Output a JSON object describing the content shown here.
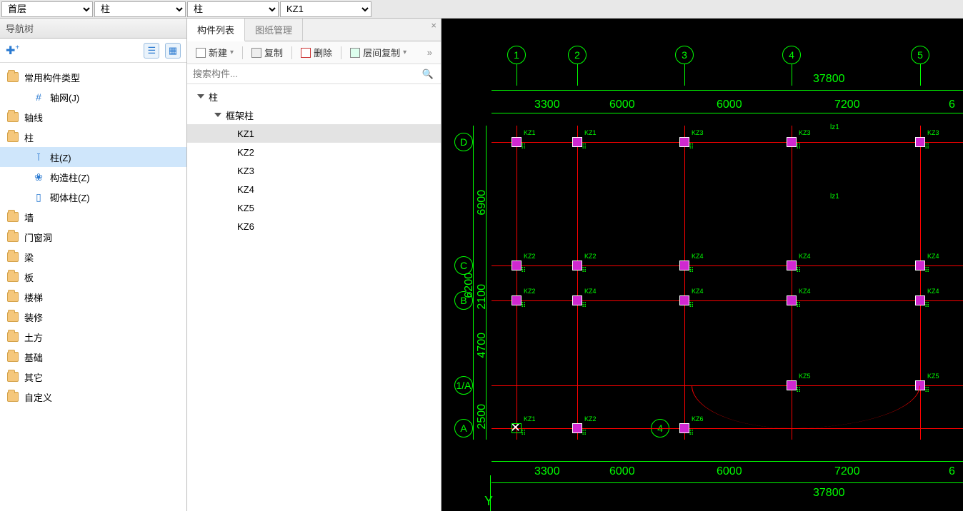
{
  "topbar": {
    "floor": "首层",
    "cat1": "柱",
    "cat2": "柱",
    "item": "KZ1"
  },
  "leftPanel": {
    "title": "导航树",
    "addTip": "+",
    "items": [
      {
        "label": "常用构件类型",
        "type": "folder",
        "lvl": 0
      },
      {
        "label": "轴网(J)",
        "type": "leaf",
        "lvl": 1,
        "icon": "#"
      },
      {
        "label": "轴线",
        "type": "folder",
        "lvl": 0
      },
      {
        "label": "柱",
        "type": "folder",
        "lvl": 0
      },
      {
        "label": "柱(Z)",
        "type": "leaf",
        "lvl": 1,
        "icon": "⊺",
        "sel": true
      },
      {
        "label": "构造柱(Z)",
        "type": "leaf",
        "lvl": 1,
        "icon": "❀"
      },
      {
        "label": "砌体柱(Z)",
        "type": "leaf",
        "lvl": 1,
        "icon": "▯"
      },
      {
        "label": "墙",
        "type": "folder",
        "lvl": 0
      },
      {
        "label": "门窗洞",
        "type": "folder",
        "lvl": 0
      },
      {
        "label": "梁",
        "type": "folder",
        "lvl": 0
      },
      {
        "label": "板",
        "type": "folder",
        "lvl": 0
      },
      {
        "label": "楼梯",
        "type": "folder",
        "lvl": 0
      },
      {
        "label": "装修",
        "type": "folder",
        "lvl": 0
      },
      {
        "label": "土方",
        "type": "folder",
        "lvl": 0
      },
      {
        "label": "基础",
        "type": "folder",
        "lvl": 0
      },
      {
        "label": "其它",
        "type": "folder",
        "lvl": 0
      },
      {
        "label": "自定义",
        "type": "folder",
        "lvl": 0
      }
    ]
  },
  "midPanel": {
    "tabs": {
      "list": "构件列表",
      "draw": "图纸管理"
    },
    "toolbar": {
      "new": "新建",
      "copy": "复制",
      "del": "删除",
      "floorcopy": "层间复制"
    },
    "searchPlaceholder": "搜索构件...",
    "tree": {
      "root": "柱",
      "group": "框架柱",
      "items": [
        "KZ1",
        "KZ2",
        "KZ3",
        "KZ4",
        "KZ5",
        "KZ6"
      ],
      "selected": "KZ1"
    }
  },
  "cad": {
    "topBubbles": [
      "1",
      "2",
      "3",
      "4",
      "5"
    ],
    "leftBubbles": [
      "D",
      "C",
      "B",
      "1/A",
      "A"
    ],
    "extraBubble": "4",
    "dimsTop": [
      "3300",
      "6000",
      "6000",
      "7200",
      "6"
    ],
    "totalTop": "37800",
    "totalBottom": "37800",
    "dimsBottom": [
      "3300",
      "6000",
      "6000",
      "7200",
      "6"
    ],
    "dimsLeft": [
      "6900",
      "2100",
      "4700",
      "2500"
    ],
    "dimsLeftInner": "6200",
    "yLabel": "Y",
    "colLabels": {
      "D": [
        "KZ1",
        "KZ1",
        "KZ3",
        "KZ3",
        "KZ3"
      ],
      "C": [
        "KZ2",
        "KZ2",
        "KZ4",
        "KZ4",
        "KZ4"
      ],
      "B": [
        "KZ2",
        "KZ4",
        "KZ4",
        "KZ4",
        "KZ4"
      ],
      "1A": [
        "KZ5",
        "KZ5"
      ],
      "A": [
        "KZ1",
        "KZ2",
        "KZ6"
      ]
    },
    "annot": [
      "lz1",
      "lz1"
    ]
  }
}
